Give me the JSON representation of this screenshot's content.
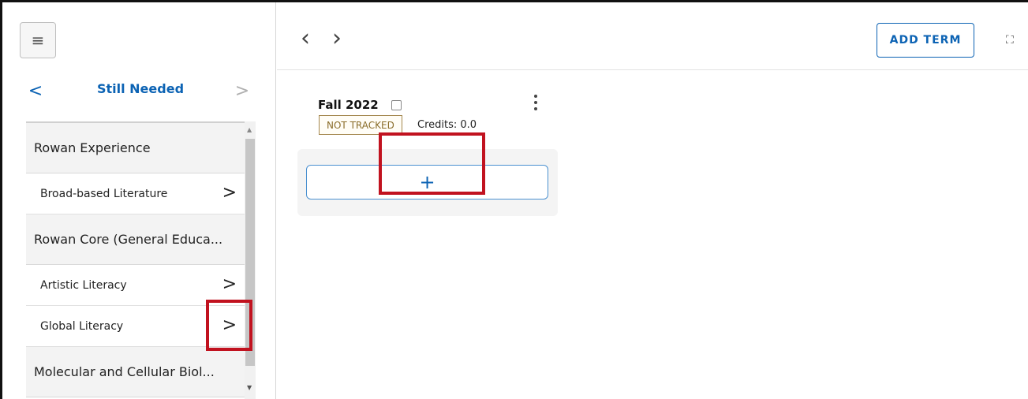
{
  "sidebar": {
    "menu_icon": "hamburger-icon",
    "title": "Still Needed",
    "prev": "<",
    "next": ">",
    "items": [
      {
        "type": "group",
        "label": "Rowan Experience"
      },
      {
        "type": "item",
        "label": "Broad-based Literature",
        "chevron": ">"
      },
      {
        "type": "group",
        "label": "Rowan Core (General Educa..."
      },
      {
        "type": "item",
        "label": "Artistic Literacy",
        "chevron": ">"
      },
      {
        "type": "item",
        "label": "Global Literacy",
        "chevron": ">"
      },
      {
        "type": "group",
        "label": "Molecular and Cellular Biol..."
      }
    ]
  },
  "topbar": {
    "back": "‹",
    "forward": "›",
    "add_term_label": "ADD TERM",
    "expand_icon": "⛶"
  },
  "term": {
    "name": "Fall 2022",
    "badge": "NOT TRACKED",
    "credits": "Credits:  0.0",
    "add_symbol": "+"
  },
  "colors": {
    "accent": "#0c63b4",
    "highlight": "#c1121f",
    "badge_border": "#a4874e"
  }
}
